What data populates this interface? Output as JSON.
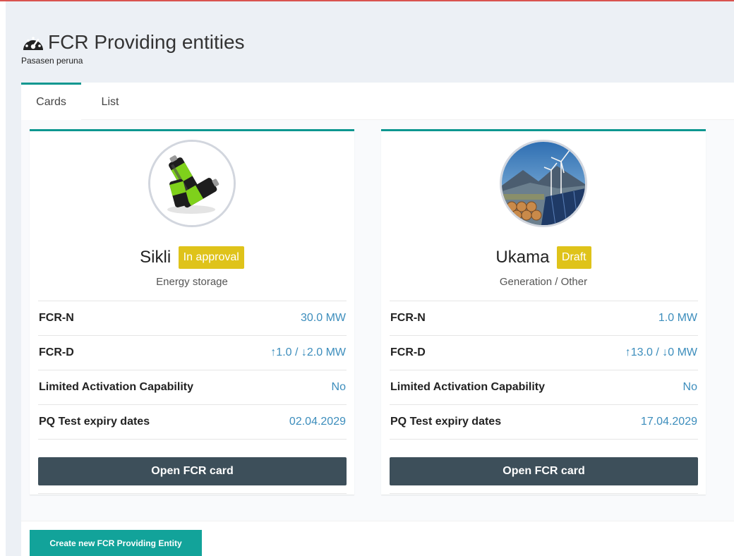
{
  "header": {
    "title": "FCR Providing entities",
    "subtitle": "Pasasen peruna",
    "icon": "dashboard-gauge-icon"
  },
  "tabs": [
    {
      "label": "Cards",
      "active": true
    },
    {
      "label": "List",
      "active": false
    }
  ],
  "cards": [
    {
      "name": "Sikli",
      "status": "In approval",
      "type": "Energy storage",
      "image": "batteries-icon",
      "properties": [
        {
          "label": "FCR-N",
          "value": "30.0 MW"
        },
        {
          "label": "FCR-D",
          "value": "↑1.0 / ↓2.0 MW"
        },
        {
          "label": "Limited Activation Capability",
          "value": "No"
        },
        {
          "label": "PQ Test expiry dates",
          "value": "02.04.2029"
        }
      ],
      "button_label": "Open FCR card"
    },
    {
      "name": "Ukama",
      "status": "Draft",
      "type": "Generation / Other",
      "image": "renewable-energy-landscape-icon",
      "properties": [
        {
          "label": "FCR-N",
          "value": "1.0 MW"
        },
        {
          "label": "FCR-D",
          "value": "↑13.0 / ↓0 MW"
        },
        {
          "label": "Limited Activation Capability",
          "value": "No"
        },
        {
          "label": "PQ Test expiry dates",
          "value": "17.04.2029"
        }
      ],
      "button_label": "Open FCR card"
    }
  ],
  "footer": {
    "create_label": "Create new FCR Providing Entity"
  },
  "colors": {
    "accent": "#0e9790",
    "badge": "#dfc31a",
    "value_link": "#3c8dbc",
    "button_dark": "#3d4f5a",
    "create_button": "#12a39a"
  }
}
